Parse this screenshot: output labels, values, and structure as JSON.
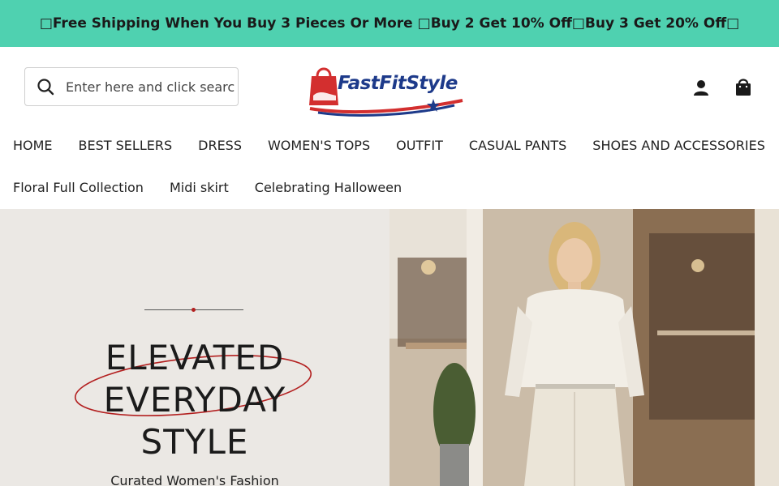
{
  "announcement": {
    "text": "□Free Shipping When You Buy 3 Pieces Or More □Buy 2 Get 10% Off□Buy 3 Get 20% Off□"
  },
  "header": {
    "search": {
      "placeholder": "Enter here and click search",
      "value": "",
      "icon": "search-icon"
    },
    "logo": {
      "text": "FastFitStyle",
      "brand_colors": [
        "#d32f2f",
        "#1d3a8a"
      ]
    },
    "icons": {
      "account": "account-icon",
      "cart": "cart-icon"
    }
  },
  "nav": {
    "row1": [
      "HOME",
      "BEST SELLERS",
      "DRESS",
      "WOMEN'S TOPS",
      "OUTFIT",
      "CASUAL PANTS",
      "SHOES AND ACCESSORIES"
    ],
    "row2": [
      "Floral Full Collection",
      "Midi skirt",
      "Celebrating Halloween"
    ]
  },
  "hero": {
    "title": "ELEVATED\nEVERYDAY\nSTYLE",
    "subtitle": "Curated Women's Fashion"
  },
  "colors": {
    "announcement_bg": "#4fd1b0",
    "hero_left_bg": "#ebe8e4",
    "accent_red": "#b32020"
  }
}
